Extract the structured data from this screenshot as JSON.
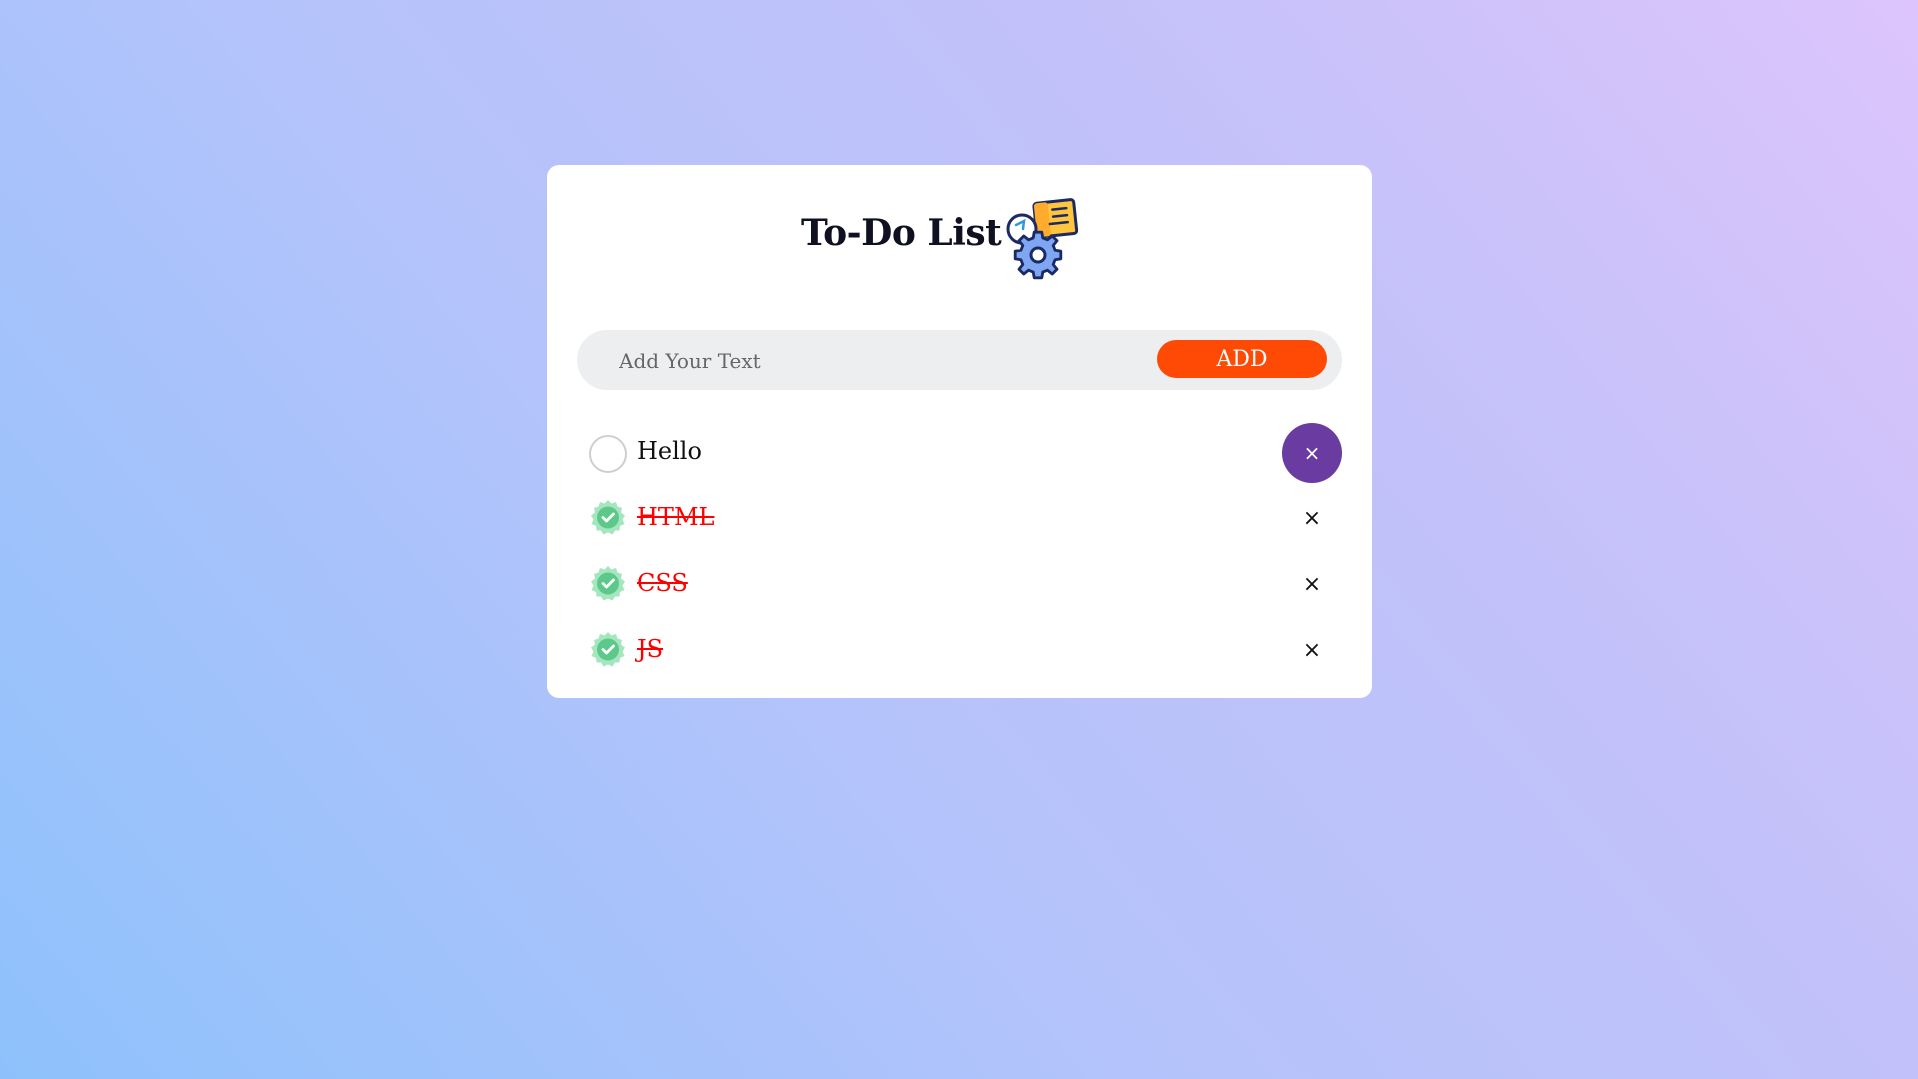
{
  "app": {
    "title": "To-Do List",
    "logo_icon": "task-settings-icon"
  },
  "input": {
    "placeholder": "Add Your Text",
    "value": ""
  },
  "add_button": {
    "label": "ADD",
    "color": "#ff4a05"
  },
  "todos": [
    {
      "text": "Hello",
      "completed": false,
      "delete_label": "×"
    },
    {
      "text": "HTML",
      "completed": true,
      "delete_label": "×"
    },
    {
      "text": "CSS",
      "completed": true,
      "delete_label": "×"
    },
    {
      "text": "JS",
      "completed": true,
      "delete_label": "×"
    }
  ],
  "colors": {
    "completed_text": "#ff0000",
    "check_badge": "#7dd8a0",
    "delete_hover": "#6a3ba1"
  }
}
